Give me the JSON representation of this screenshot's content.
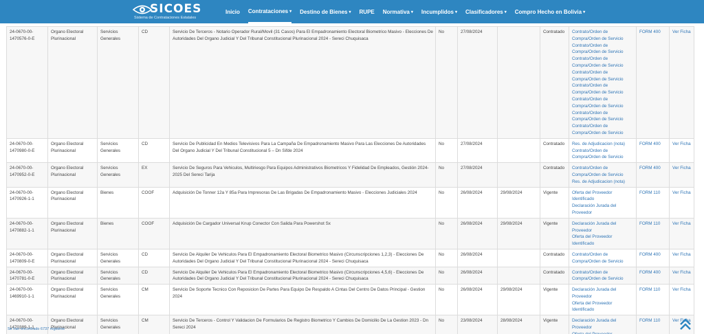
{
  "header": {
    "logo_text": "SICOES",
    "logo_sub": "Sistema de Contrataciones Estatales",
    "nav": [
      {
        "label": "Inicio",
        "dropdown": false,
        "active": false
      },
      {
        "label": "Contrataciones",
        "dropdown": true,
        "active": true
      },
      {
        "label": "Destino de Bienes",
        "dropdown": true,
        "active": false
      },
      {
        "label": "RUPE",
        "dropdown": false,
        "active": false
      },
      {
        "label": "Normativa",
        "dropdown": true,
        "active": false
      },
      {
        "label": "Incumplidos",
        "dropdown": true,
        "active": false
      },
      {
        "label": "Clasificadores",
        "dropdown": true,
        "active": false
      },
      {
        "label": "Compro Hecho en Bolivia",
        "dropdown": true,
        "active": false
      }
    ]
  },
  "rows": [
    {
      "cuce": "24-0670-00-1470576-0-E",
      "entidad": "Organo Electoral Plurinacional",
      "tipo": "Servicios Generales",
      "modalidad": "CD",
      "objeto": "Servicio De Terceros - Notario Operador Rural/Movil (31 Casos) Para El Empadronamiento Electoral Biometrico Masivo - Elecciones De Autoridades Del Organo Judicial Y Del Tribunal Constitucional Plurinacional 2024 - Sereci Chuquisaca",
      "subasta": "No",
      "fecha_pub": "27/08/2024",
      "fecha_pres": "",
      "estado": "Contratado",
      "docs": [
        "Contrato/Orden de Compra/Orden de Servicio",
        "Contrato/Orden de Compra/Orden de Servicio",
        "Contrato/Orden de Compra/Orden de Servicio",
        "Contrato/Orden de Compra/Orden de Servicio",
        "Contrato/Orden de Compra/Orden de Servicio",
        "Contrato/Orden de Compra/Orden de Servicio",
        "Contrato/Orden de Compra/Orden de Servicio",
        "Contrato/Orden de Compra/Orden de Servicio"
      ],
      "form": "FORM 400",
      "ficha": "Ver Ficha"
    },
    {
      "cuce": "24-0670-00-1470980-0-E",
      "entidad": "Organo Electoral Plurinacional",
      "tipo": "Servicios Generales",
      "modalidad": "CD",
      "objeto": "Servicio De Publicidad En Medios Televisivos Para La Campaña De Empadronamiento Masivo Para Las Elecciones De Autoridades Del Organo Judicial Y Del Tribunal Constitucional 5 – Dn Sifde 2024",
      "subasta": "No",
      "fecha_pub": "27/08/2024",
      "fecha_pres": "",
      "estado": "Contratado",
      "docs": [
        "Res. de Adjudicacion (nota)",
        "Contrato/Orden de Compra/Orden de Servicio"
      ],
      "form": "FORM 400",
      "ficha": "Ver Ficha"
    },
    {
      "cuce": "24-0670-00-1470952-0-E",
      "entidad": "Organo Electoral Plurinacional",
      "tipo": "Servicios Generales",
      "modalidad": "EX",
      "objeto": "Servicio De Seguros Para Vehiculos, Multiriesgo Para Equipos Administrativos Biometricos Y Fidelidad De Empleados, Gestión 2024-2025 Del Sereci Tarija",
      "subasta": "No",
      "fecha_pub": "27/08/2024",
      "fecha_pres": "",
      "estado": "Contratado",
      "docs": [
        "Contrato/Orden de Compra/Orden de Servicio",
        "Res. de Adjudicacion (nota)"
      ],
      "form": "FORM 400",
      "ficha": "Ver Ficha"
    },
    {
      "cuce": "24-0670-00-1470926-1-1",
      "entidad": "Organo Electoral Plurinacional",
      "tipo": "Bienes",
      "modalidad": "COOF",
      "objeto": "Adquisición De Tonner 12a Y 85a Para Impresoras De Las Brigadas De Empadronamiento Masivo - Elecciones Judiciales 2024",
      "subasta": "No",
      "fecha_pub": "26/08/2024",
      "fecha_pres": "29/08/2024",
      "estado": "Vigente",
      "docs": [
        "Oferta del Proveedor Identificado",
        "Declaración Jurada del Proveedor"
      ],
      "form": "FORM 110",
      "ficha": "Ver Ficha"
    },
    {
      "cuce": "24-0670-00-1470882-1-1",
      "entidad": "Organo Electoral Plurinacional",
      "tipo": "Bienes",
      "modalidad": "COOF",
      "objeto": "Adquisición De Cargador Universal Knup Conector Con Salida Para Powershot Sx",
      "subasta": "No",
      "fecha_pub": "26/08/2024",
      "fecha_pres": "29/08/2024",
      "estado": "Vigente",
      "docs": [
        "Declaración Jurada del Proveedor",
        "Oferta del Proveedor Identificado"
      ],
      "form": "FORM 110",
      "ficha": "Ver Ficha"
    },
    {
      "cuce": "24-0670-00-1470809-0-E",
      "entidad": "Organo Electoral Plurinacional",
      "tipo": "Servicios Generales",
      "modalidad": "CD",
      "objeto": "Servicio De Alquiler De Vehiculos Para El Empadronamiento Electoral Biometrico Masivo (Circunscripciones 1,2,3) - Elecciones De Autoridades Del Organo Judicial Y Del Tribunal Constitucional Plurinacional 2024 - Sereci Chuquisaca",
      "subasta": "No",
      "fecha_pub": "26/08/2024",
      "fecha_pres": "",
      "estado": "Contratado",
      "docs": [
        "Contrato/Orden de Compra/Orden de Servicio"
      ],
      "form": "FORM 400",
      "ficha": "Ver Ficha"
    },
    {
      "cuce": "24-0670-00-1470781-0-E",
      "entidad": "Organo Electoral Plurinacional",
      "tipo": "Servicios Generales",
      "modalidad": "CD",
      "objeto": "Servicio De Alquiler De Vehiculos Para El Empadronamiento Electoral Biometrico Masivo (Circunscripciones 4,5,6) - Elecciones De Autoridades Del Organo Judicial Y Del Tribunal Constitucional Plurinacional 2024 - Sereci Chuquisaca",
      "subasta": "No",
      "fecha_pub": "26/08/2024",
      "fecha_pres": "",
      "estado": "Contratado",
      "docs": [
        "Contrato/Orden de Compra/Orden de Servicio"
      ],
      "form": "FORM 400",
      "ficha": "Ver Ficha"
    },
    {
      "cuce": "24-0670-00-1469910-1-1",
      "entidad": "Organo Electoral Plurinacional",
      "tipo": "Servicios Generales",
      "modalidad": "CM",
      "objeto": "Servicio De Soporte Tecnico Con Reposicion De Partes Para Equipo De Respaldo A Cintas Del Centro De Datos Principal - Gestion 2024",
      "subasta": "No",
      "fecha_pub": "26/08/2024",
      "fecha_pres": "29/08/2024",
      "estado": "Vigente",
      "docs": [
        "Declaración Jurada del Proveedor",
        "Oferta del Proveedor Identificado"
      ],
      "form": "FORM 110",
      "ficha": "Ver Ficha"
    },
    {
      "cuce": "24-0670-00-1470389-1-1",
      "entidad": "Organo Electoral Plurinacional",
      "tipo": "Servicios Generales",
      "modalidad": "CM",
      "objeto": "Servicio De Terceros - Control Y Validacion De Formularios De Registro Biometrico Y Cambios De Domicilio De La Gestion 2023 - Dn Sereci 2024",
      "subasta": "No",
      "fecha_pub": "23/08/2024",
      "fecha_pres": "28/08/2024",
      "estado": "Vigente",
      "docs": [
        "Declaración Jurada del Proveedor",
        "Oferta del Proveedor Identificado"
      ],
      "form": "FORM 110",
      "ficha": "Ver Ficha"
    }
  ],
  "footer": {
    "records_text": "Se han encontrado 6737 registros"
  },
  "icons": {
    "scroll_top": "chevron-double-up-icon",
    "logo": "eye-logo-icon"
  },
  "colors": {
    "header_bg": "#2e86c1",
    "link": "#2e74b5",
    "scroll_top": "#2e86c1"
  }
}
